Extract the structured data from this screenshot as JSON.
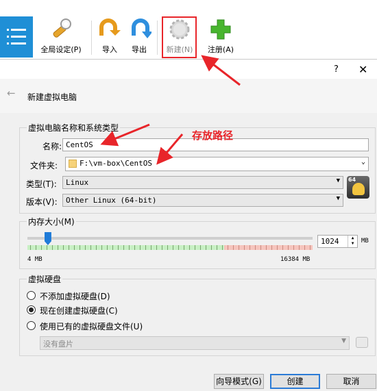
{
  "toolbar": {
    "global_settings": "全局设定(P)",
    "import": "导入",
    "export": "导出",
    "new": "新建(N)",
    "register": "注册(A)"
  },
  "dialog": {
    "help": "?",
    "close": "✕",
    "back": "←",
    "title": "新建虚拟电脑",
    "name_group": {
      "legend": "虚拟电脑名称和系统类型",
      "name_label": "名称:",
      "name_value": "CentOS",
      "folder_label": "文件夹:",
      "folder_value": "F:\\vm-box\\CentOS",
      "type_label": "类型(T):",
      "type_value": "Linux",
      "version_label": "版本(V):",
      "version_value": "Other Linux (64-bit)",
      "os_badge": "64"
    },
    "memory_group": {
      "legend": "内存大小(M)",
      "value": "1024",
      "unit": "MB",
      "min_label": "4 MB",
      "max_label": "16384 MB",
      "slider_fraction": 0.0623
    },
    "disk_group": {
      "legend": "虚拟硬盘",
      "options": [
        "不添加虚拟硬盘(D)",
        "现在创建虚拟硬盘(C)",
        "使用已有的虚拟硬盘文件(U)"
      ],
      "selected_index": 1,
      "disk_placeholder": "没有盘片"
    },
    "buttons": {
      "guided": "向导模式(G)",
      "create": "创建",
      "cancel": "取消"
    }
  },
  "annotation": {
    "storage_path": "存放路径",
    "color": "#e8252a"
  },
  "colors": {
    "menu_blue": "#1f8fd6",
    "default_button_border": "#2b7bd6"
  }
}
